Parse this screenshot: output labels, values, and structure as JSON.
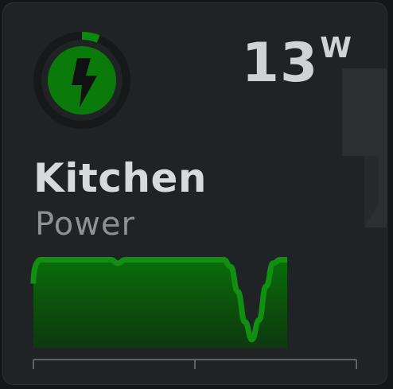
{
  "entity": {
    "name": "Kitchen",
    "type_label": "Power",
    "value": "13",
    "unit": "W"
  },
  "icon": {
    "name": "lightning-bolt-icon",
    "ring_fill_fraction": 0.06
  },
  "colors": {
    "accent": "#0c7a0c",
    "accent_bright": "#118f11",
    "card_bg": "#202325",
    "text_primary": "#d7d9da",
    "text_secondary": "#8e9293"
  },
  "chart_data": {
    "type": "area",
    "x": [
      0,
      1,
      2,
      3,
      4,
      5,
      6,
      7,
      8,
      9,
      10,
      11,
      12,
      13,
      14,
      15,
      16,
      17,
      18,
      19,
      20,
      21,
      22,
      23,
      24,
      25,
      26,
      27,
      28,
      29,
      30,
      31,
      32,
      33,
      34,
      35,
      36,
      37,
      38,
      39,
      40
    ],
    "series": [
      {
        "values": [
          13.0,
          13.0,
          13.0,
          13.0,
          13.0,
          13.0,
          13.0,
          13.0,
          13.0,
          13.0,
          13.0,
          13.0,
          12.8,
          13.0,
          13.0,
          13.0,
          13.0,
          13.0,
          13.0,
          13.0,
          13.0,
          13.0,
          13.0,
          13.0,
          13.0,
          13.0,
          13.0,
          13.0,
          12.6,
          11.2,
          9.5,
          8.5,
          9.6,
          11.5,
          12.8,
          13.0,
          13.0
        ]
      }
    ],
    "grid": false,
    "legend": "none"
  }
}
